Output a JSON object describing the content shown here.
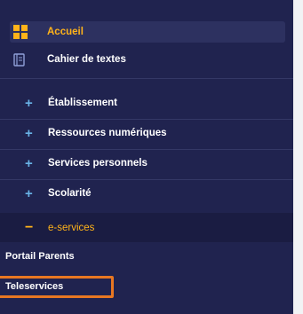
{
  "nav": {
    "home": {
      "label": "Accueil",
      "icon": "grid-icon",
      "color": "#ffb31a"
    },
    "textbook": {
      "label": "Cahier de textes",
      "icon": "book-icon"
    },
    "sections": [
      {
        "label": "Établissement",
        "icon": "plus-icon"
      },
      {
        "label": "Ressources numériques",
        "icon": "plus-icon"
      },
      {
        "label": "Services personnels",
        "icon": "plus-icon"
      },
      {
        "label": "Scolarité",
        "icon": "plus-icon"
      }
    ],
    "expanded": {
      "label": "e-services",
      "icon": "minus-icon",
      "items": [
        {
          "label": "Portail Parents"
        },
        {
          "label": "Teleservices",
          "highlighted": true
        }
      ]
    }
  },
  "colors": {
    "sidebar_bg": "#20234f",
    "accent": "#ffb31a",
    "plus": "#69b3e7",
    "highlight_border": "#e87722"
  }
}
